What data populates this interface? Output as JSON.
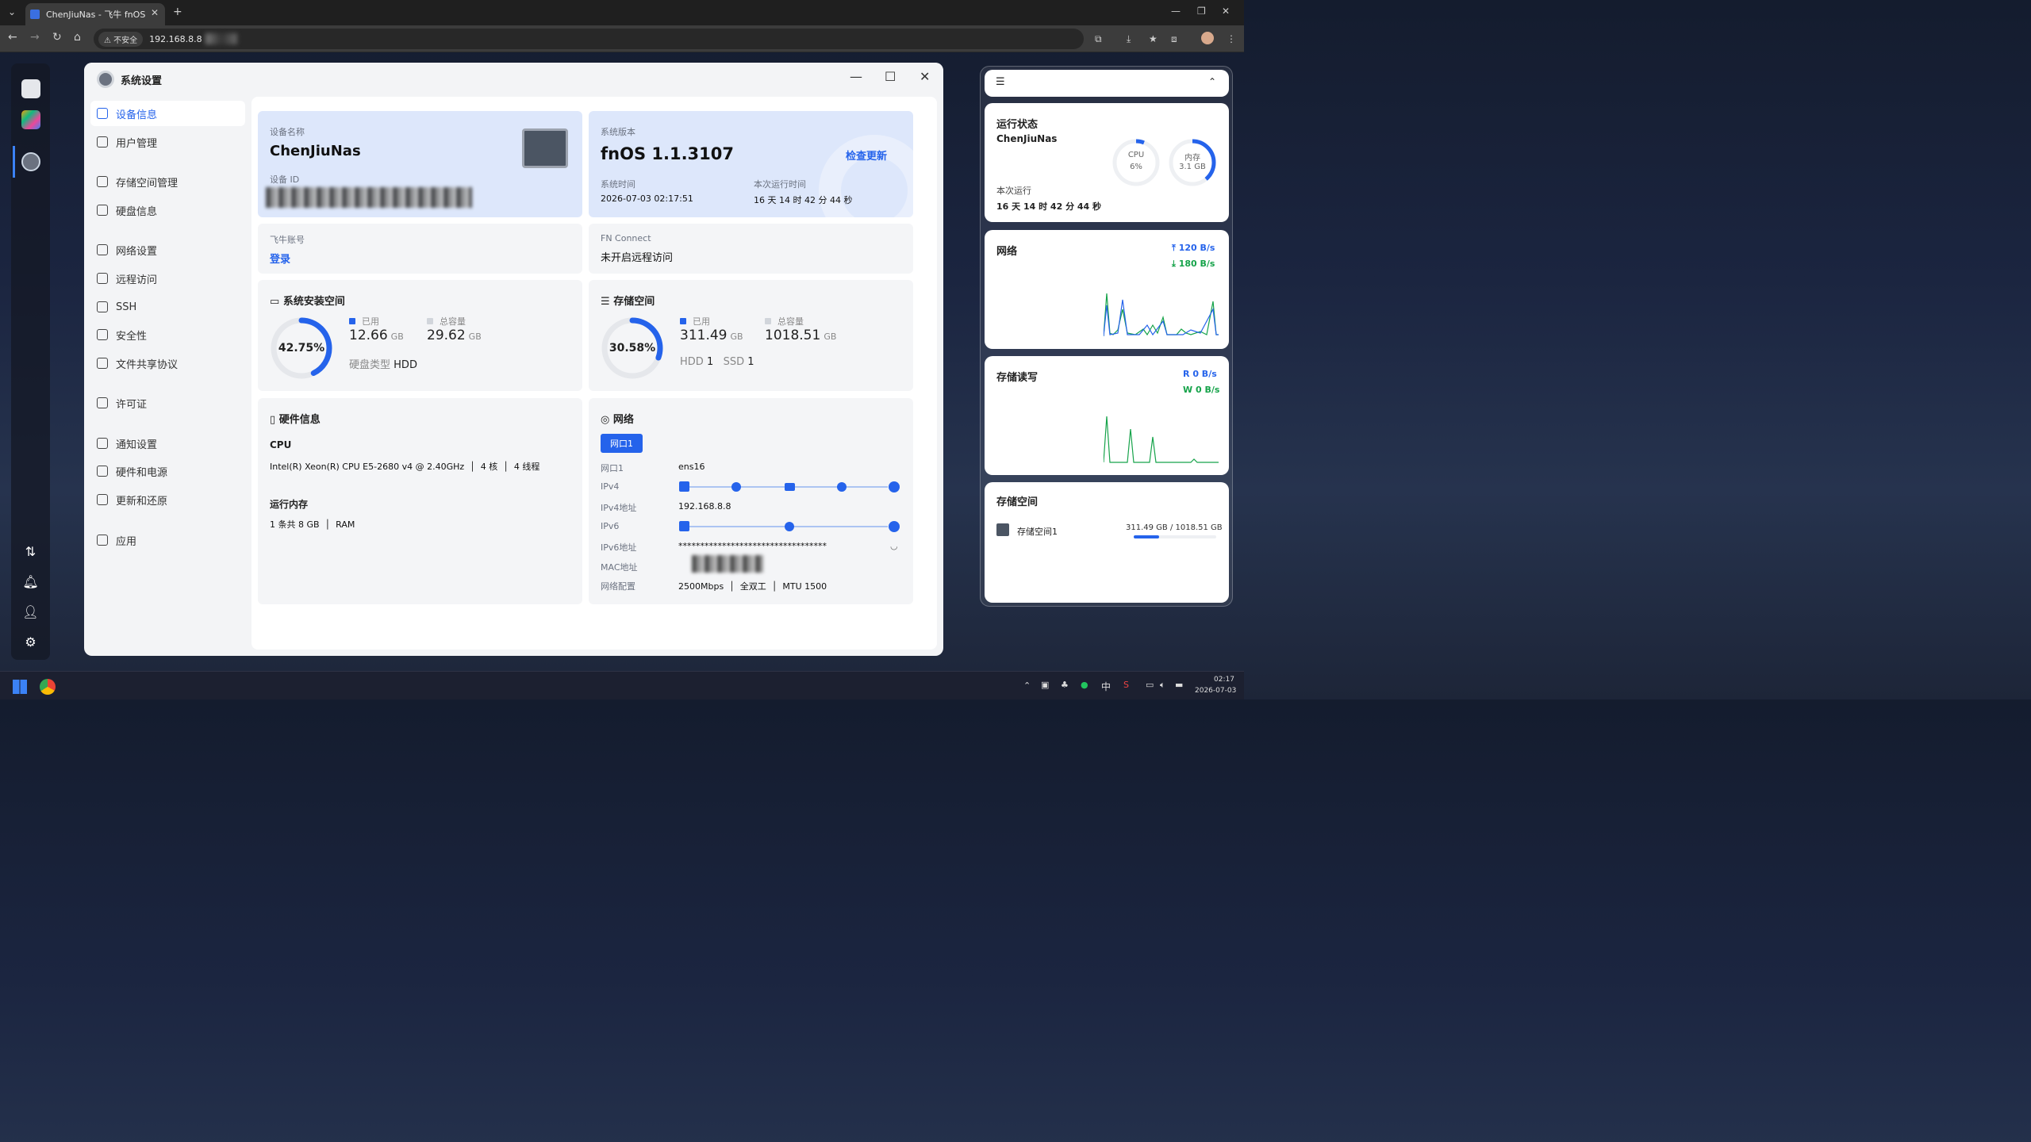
{
  "browser": {
    "tab_title": "ChenJiuNas - 飞牛 fnOS",
    "insecure": "不安全",
    "url": "192.168.8.8"
  },
  "window": {
    "title": "系统设置"
  },
  "sidebar": {
    "items": [
      {
        "label": "设备信息",
        "active": true
      },
      {
        "label": "用户管理"
      },
      {
        "label": "存储空间管理"
      },
      {
        "label": "硬盘信息"
      },
      {
        "label": "网络设置"
      },
      {
        "label": "远程访问"
      },
      {
        "label": "SSH"
      },
      {
        "label": "安全性"
      },
      {
        "label": "文件共享协议"
      },
      {
        "label": "许可证"
      },
      {
        "label": "通知设置"
      },
      {
        "label": "硬件和电源"
      },
      {
        "label": "更新和还原"
      },
      {
        "label": "应用"
      }
    ]
  },
  "device": {
    "name_label": "设备名称",
    "name": "ChenJiuNas",
    "id_label": "设备 ID"
  },
  "system": {
    "version_label": "系统版本",
    "version": "fnOS  1.1.3107",
    "check_update": "检查更新",
    "time_label": "系统时间",
    "time": "2026-07-03 02:17:51",
    "uptime_label": "本次运行时间",
    "uptime": "16 天 14 时 42 分 44 秒"
  },
  "account": {
    "label": "飞牛账号",
    "login": "登录"
  },
  "fnconnect": {
    "label": "FN Connect",
    "status": "未开启远程访问"
  },
  "sys_space": {
    "title": "系统安装空间",
    "percent": "42.75%",
    "fraction": 0.4275,
    "used_label": "已用",
    "used": "12.66",
    "used_unit": "GB",
    "total_label": "总容量",
    "total": "29.62",
    "total_unit": "GB",
    "disk_type_label": "硬盘类型",
    "disk_type": "HDD"
  },
  "storage": {
    "title": "存储空间",
    "percent": "30.58%",
    "fraction": 0.3058,
    "used_label": "已用",
    "used": "311.49",
    "used_unit": "GB",
    "total_label": "总容量",
    "total": "1018.51",
    "total_unit": "GB",
    "hdd": "HDD",
    "hdd_count": "1",
    "ssd": "SSD",
    "ssd_count": "1"
  },
  "hardware": {
    "title": "硬件信息",
    "cpu_label": "CPU",
    "cpu": "Intel(R) Xeon(R) CPU E5-2680 v4 @ 2.40GHz",
    "cores": "4 核",
    "threads": "4 线程",
    "ram_label": "运行内存",
    "ram": "1 条共 8 GB",
    "ram_type": "RAM"
  },
  "network": {
    "title": "网络",
    "port_tab": "网口1",
    "rows": [
      {
        "k": "网口1",
        "v": "ens16"
      },
      {
        "k": "IPv4",
        "v": ""
      },
      {
        "k": "IPv4地址",
        "v": "192.168.8.8"
      },
      {
        "k": "IPv6",
        "v": ""
      },
      {
        "k": "IPv6地址",
        "v": "**********************************"
      },
      {
        "k": "MAC地址",
        "v": ""
      }
    ],
    "config_label": "网络配置",
    "speed": "2500Mbps",
    "duplex": "全双工",
    "mtu": "MTU 1500"
  },
  "widgets": {
    "status": {
      "title": "运行状态",
      "host": "ChenJiuNas",
      "cpu_label": "CPU",
      "cpu": "6%",
      "cpu_fraction": 0.06,
      "mem_label": "内存",
      "mem": "3.1 GB",
      "mem_fraction": 0.39,
      "uptime_label": "本次运行",
      "uptime": "16 天 14 时 42 分 44 秒"
    },
    "net": {
      "title": "网络",
      "up": "120 B/s",
      "down": "180 B/s"
    },
    "io": {
      "title": "存储读写",
      "r_label": "R",
      "r": "0 B/s",
      "w_label": "W",
      "w": "0 B/s"
    },
    "space": {
      "title": "存储空间",
      "name": "存储空间1",
      "usage": "311.49 GB / 1018.51 GB",
      "fraction": 0.3058
    }
  },
  "taskbar": {
    "ime": "中",
    "time": "02:17",
    "date": "2026-07-03"
  },
  "colors": {
    "accent": "#2563eb",
    "green": "#16a34a"
  }
}
